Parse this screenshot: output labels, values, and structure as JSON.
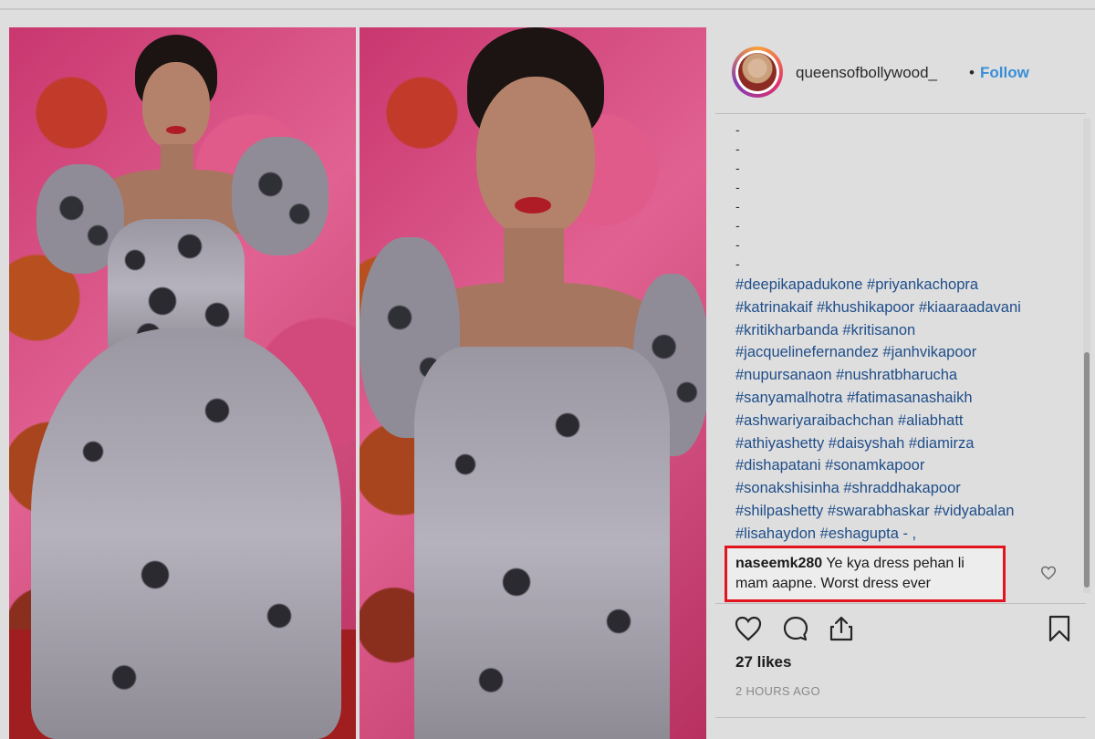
{
  "post": {
    "username": "queensofbollywood_",
    "separator": "•",
    "follow_label": "Follow",
    "caption_dashes": [
      "-",
      "-",
      "-",
      "-",
      "-",
      "-",
      "-",
      "-"
    ],
    "hashtag_lines": [
      "#deepikapadukone #priyankachopra",
      "#katrinakaif #khushikapoor #kiaaraadavani",
      "#kritikharbanda #kritisanon",
      "#jacquelinefernandez #janhvikapoor",
      "#nupursanaon #nushratbharucha",
      "#sanyamalhotra #fatimasanashaikh",
      "#ashwariyaraibachchan #aliabhatt",
      "#athiyashetty #daisyshah #diamirza",
      "#dishapatani #sonamkapoor",
      "#sonakshisinha #shraddhakapoor",
      "#shilpashetty #swarabhaskar #vidyabalan",
      "#lisahaydon #eshagupta - ,"
    ],
    "highlighted_comment": {
      "user": "naseemk280",
      "text": "Ye kya dress pehan li mam aapne. Worst dress ever"
    },
    "likes": "27 likes",
    "timestamp": "2 HOURS AGO"
  },
  "colors": {
    "follow": "#3a8ed8",
    "hashtag": "#1f4e8a",
    "highlight_border": "#e2141e"
  },
  "icons": {
    "like": "heart-icon",
    "comment": "comment-icon",
    "share": "share-icon",
    "save": "bookmark-icon",
    "comment_like": "small-heart-icon"
  }
}
